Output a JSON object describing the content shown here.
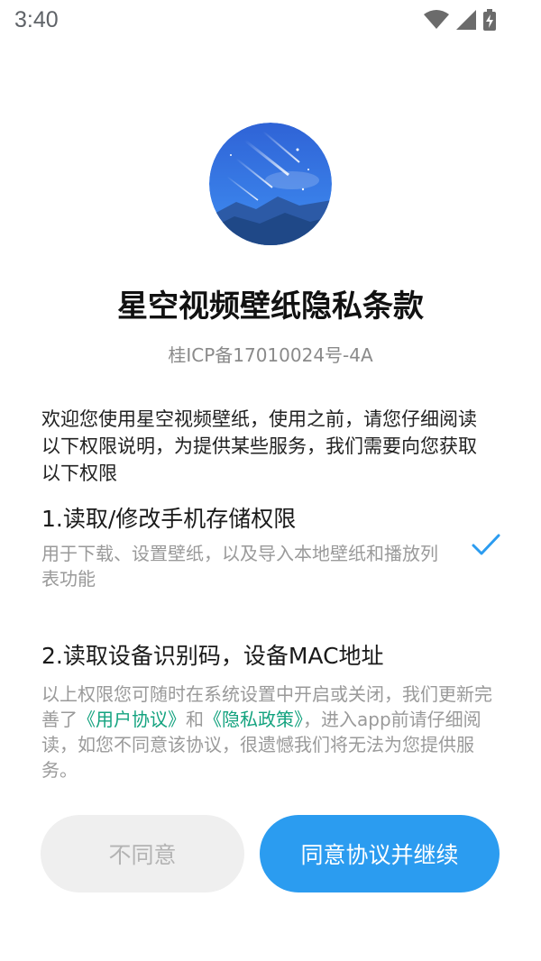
{
  "status_bar": {
    "time": "3:40",
    "icons": [
      "wifi-icon",
      "signal-icon",
      "battery-charging-icon"
    ]
  },
  "app": {
    "logo": "starry-sky-logo",
    "title": "星空视频壁纸隐私条款",
    "icp": "桂ICP备17010024号-4A"
  },
  "intro": "欢迎您使用星空视频壁纸，使用之前，请您仔细阅读以下权限说明，为提供某些服务，我们需要向您获取以下权限",
  "permissions": [
    {
      "title": "1.读取/修改手机存储权限",
      "description": "用于下载、设置壁纸，以及导入本地壁纸和播放列表功能",
      "checked": true
    },
    {
      "title": "2.读取设备识别码，设备MAC地址"
    }
  ],
  "notice": {
    "part1": "以上权限您可随时在系统设置中开启或关闭，我们更新完善了",
    "user_agreement": "《用户协议》",
    "and": "和",
    "privacy_policy": "《隐私政策》",
    "part2": "，进入app前请仔细阅读，如您不同意该协议，很遗憾我们将无法为您提供服务。"
  },
  "buttons": {
    "disagree": "不同意",
    "agree": "同意协议并继续"
  },
  "colors": {
    "accent": "#2b9cf0",
    "link": "#14a37f",
    "check": "#2b9cf0"
  }
}
